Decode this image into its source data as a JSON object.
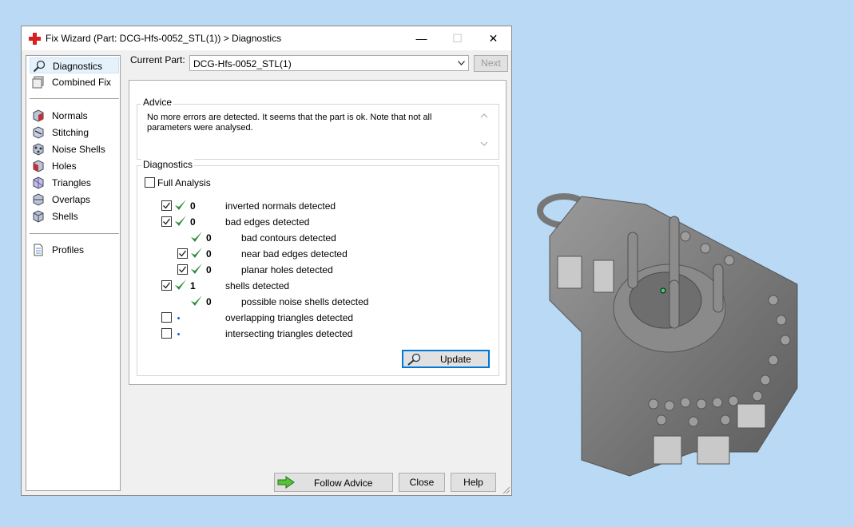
{
  "window": {
    "title": "Fix Wizard (Part: DCG-Hfs-0052_STL(1)) > Diagnostics",
    "minimize_glyph": "—",
    "maximize_glyph": "☐",
    "close_glyph": "✕"
  },
  "sidebar": {
    "items": [
      {
        "label": "Diagnostics",
        "icon": "magnifier-icon"
      },
      {
        "label": "Combined Fix",
        "icon": "layers-icon"
      },
      {
        "label": "Normals",
        "icon": "cube-icon"
      },
      {
        "label": "Stitching",
        "icon": "stitching-icon"
      },
      {
        "label": "Noise Shells",
        "icon": "noise-shells-icon"
      },
      {
        "label": "Holes",
        "icon": "holes-icon"
      },
      {
        "label": "Triangles",
        "icon": "triangles-icon"
      },
      {
        "label": "Overlaps",
        "icon": "overlaps-icon"
      },
      {
        "label": "Shells",
        "icon": "shells-icon"
      },
      {
        "label": "Profiles",
        "icon": "document-icon"
      }
    ]
  },
  "header": {
    "current_part_label": "Current Part:",
    "current_part_value": "DCG-Hfs-0052_STL(1)",
    "next_label": "Next"
  },
  "advice": {
    "title": "Advice",
    "text": "No more errors are detected. It seems that the part is ok. Note that not all parameters were analysed."
  },
  "diagnostics": {
    "title": "Diagnostics",
    "full_analysis_label": "Full Analysis",
    "rows": [
      {
        "count": "0",
        "label": "inverted normals detected"
      },
      {
        "count": "0",
        "label": "bad edges detected"
      },
      {
        "count": "0",
        "label": "bad contours detected"
      },
      {
        "count": "0",
        "label": "near bad edges detected"
      },
      {
        "count": "0",
        "label": "planar holes detected"
      },
      {
        "count": "1",
        "label": "shells detected"
      },
      {
        "count": "0",
        "label": "possible noise shells detected"
      },
      {
        "count": "",
        "label": "overlapping triangles detected"
      },
      {
        "count": "",
        "label": "intersecting triangles detected"
      }
    ],
    "update_label": "Update"
  },
  "footer": {
    "follow_advice_label": "Follow Advice",
    "close_label": "Close",
    "help_label": "Help"
  },
  "colors": {
    "desktop": "#b9d9f4",
    "check_green": "#2e8b3a",
    "model_grey": "#7d7d7d"
  }
}
